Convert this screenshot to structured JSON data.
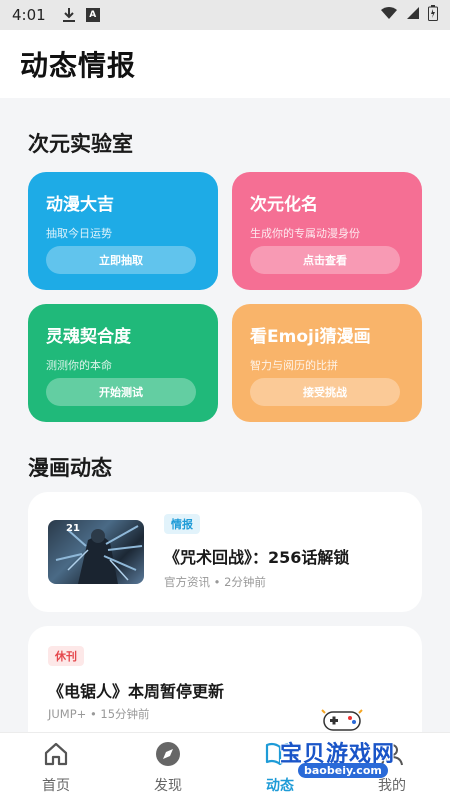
{
  "status_bar": {
    "time": "4:01"
  },
  "header": {
    "title": "动态情报"
  },
  "lab": {
    "title": "次元实验室",
    "cards": [
      {
        "title": "动漫大吉",
        "subtitle": "抽取今日运势",
        "button": "立即抽取",
        "color": "#1eabe6"
      },
      {
        "title": "次元化名",
        "subtitle": "生成你的专属动漫身份",
        "button": "点击查看",
        "color": "#f56f94"
      },
      {
        "title": "灵魂契合度",
        "subtitle": "测测你的本命",
        "button": "开始测试",
        "color": "#20b97a"
      },
      {
        "title": "看Emoji猜漫画",
        "subtitle": "智力与阅历的比拼",
        "button": "接受挑战",
        "color": "#f9b46a"
      }
    ]
  },
  "news": {
    "title": "漫画动态",
    "items": [
      {
        "tag": "情报",
        "title": "《咒术回战》：256话解锁",
        "meta": "官方资讯 • 2分钟前",
        "thumb_label": "21"
      },
      {
        "tag": "休刊",
        "title": "《电锯人》本周暂停更新",
        "meta": "JUMP+ • 15分钟前"
      }
    ]
  },
  "nav": {
    "items": [
      {
        "label": "首页",
        "icon": "home-icon"
      },
      {
        "label": "发现",
        "icon": "compass-icon"
      },
      {
        "label": "动态",
        "icon": "book-icon"
      },
      {
        "label": "我的",
        "icon": "user-icon"
      }
    ],
    "active_color": "#1e9bd7"
  },
  "watermark": {
    "text": "宝贝游戏网",
    "url": "baobeiy.com"
  }
}
